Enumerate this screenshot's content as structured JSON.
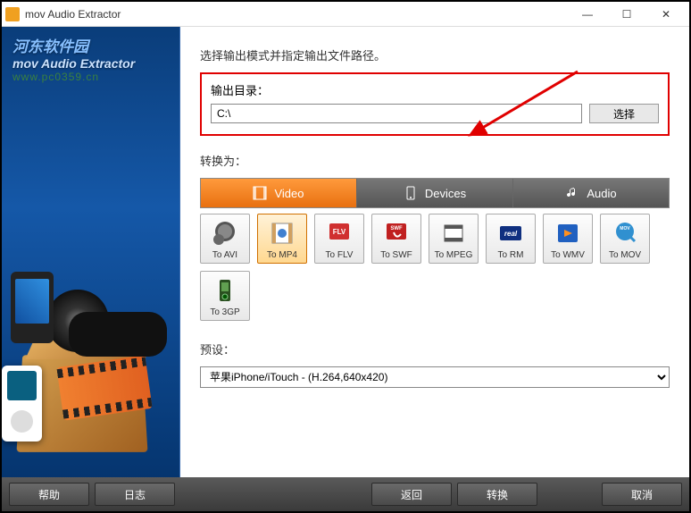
{
  "window": {
    "title": "mov Audio Extractor",
    "btn_min": "—",
    "btn_max": "☐",
    "btn_close": "✕"
  },
  "logo": {
    "main": "河东软件园",
    "head": "mov Audio Extractor",
    "site": "www.pc0359.cn"
  },
  "instructions": "选择输出模式并指定输出文件路径。",
  "output": {
    "label": "输出目录：",
    "value": "C:\\",
    "browse": "选择"
  },
  "convert_label": "转换为：",
  "tabs": {
    "video": "Video",
    "devices": "Devices",
    "audio": "Audio"
  },
  "formats": [
    {
      "label": "To AVI",
      "key": "avi"
    },
    {
      "label": "To MP4",
      "key": "mp4",
      "selected": true
    },
    {
      "label": "To FLV",
      "key": "flv"
    },
    {
      "label": "To SWF",
      "key": "swf"
    },
    {
      "label": "To MPEG",
      "key": "mpeg"
    },
    {
      "label": "To RM",
      "key": "rm"
    },
    {
      "label": "To WMV",
      "key": "wmv"
    },
    {
      "label": "To MOV",
      "key": "mov"
    },
    {
      "label": "To 3GP",
      "key": "3gp"
    }
  ],
  "preset": {
    "label": "预设：",
    "selected": "苹果iPhone/iTouch - (H.264,640x420)"
  },
  "bottom": {
    "help": "帮助",
    "log": "日志",
    "back": "返回",
    "convert": "转换",
    "cancel": "取消"
  }
}
